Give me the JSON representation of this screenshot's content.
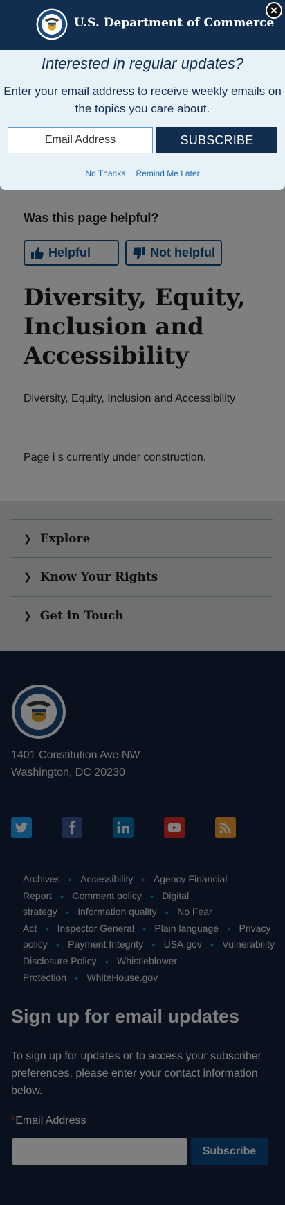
{
  "feedback": {
    "question": "Was this page helpful?",
    "helpful": "Helpful",
    "not_helpful": "Not helpful"
  },
  "page": {
    "title": "Diversity, Equity, Inclusion and Accessibility",
    "subtitle": "Diversity, Equity, Inclusion and Accessibility",
    "body": "Page i s currently under construction."
  },
  "accordion": [
    "Explore",
    "Know Your Rights",
    "Get in Touch"
  ],
  "footer": {
    "address_line1": "1401 Constitution Ave NW",
    "address_line2": "Washington, DC 20230",
    "social": [
      {
        "icon": "twitter-icon",
        "color": "#1da1f2"
      },
      {
        "icon": "facebook-icon",
        "color": "#3b5998"
      },
      {
        "icon": "linkedin-icon",
        "color": "#0077b5"
      },
      {
        "icon": "youtube-icon",
        "color": "#e52d27"
      },
      {
        "icon": "rss-icon",
        "color": "#f0a030"
      }
    ],
    "links": [
      "Archives",
      "Accessibility",
      "Agency Financial Report",
      "Comment policy",
      "Digital strategy",
      "Information quality",
      "No Fear Act",
      "Inspector General",
      "Plain language",
      "Privacy policy",
      "Payment Integrity",
      "USA.gov",
      "Vulnerability Disclosure Policy",
      "Whistleblower Protection",
      "WhiteHouse.gov"
    ],
    "signup_heading": "Sign up for email updates",
    "signup_text": "To sign up for updates or to access your subscriber preferences, please enter your contact information below.",
    "email_label": "Email Address",
    "required_mark": "*",
    "subscribe": "Subscribe"
  },
  "modal": {
    "brand": "U.S. Department of Commerce",
    "question": "Interested in regular updates?",
    "description": "Enter your email address to receive weekly emails on the topics you care about.",
    "email_placeholder": "Email Address",
    "subscribe": "SUBSCRIBE",
    "no_thanks": "No Thanks",
    "remind_later": "Remind Me Later",
    "close_glyph": "✕"
  },
  "colors": {
    "navy": "#112e51",
    "primary": "#0b4a8a",
    "modal_bg": "#e7f1f8",
    "footer_bg": "#12203d"
  }
}
